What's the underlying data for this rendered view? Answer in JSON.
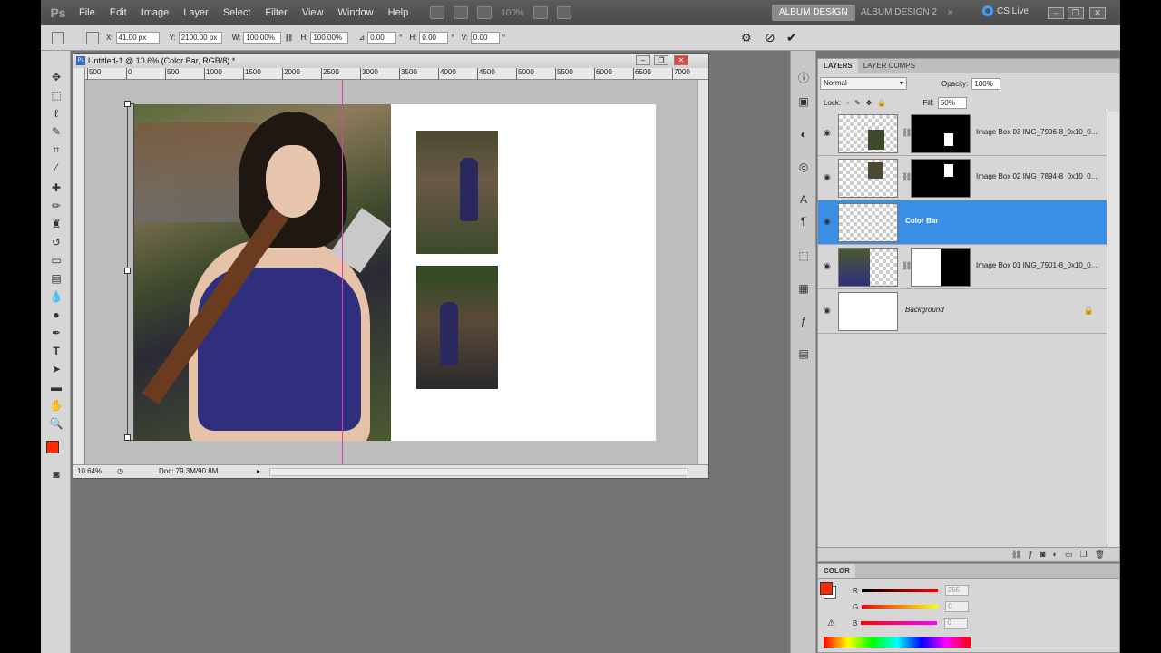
{
  "app": {
    "logo": "Ps"
  },
  "menu": [
    "File",
    "Edit",
    "Image",
    "Layer",
    "Select",
    "Filter",
    "View",
    "Window",
    "Help"
  ],
  "menubar": {
    "zoom": "100%",
    "workspaces": [
      "ALBUM DESIGN",
      "ALBUM DESIGN 2"
    ],
    "more": "»",
    "cs_live": "CS Live"
  },
  "options": {
    "x_label": "X:",
    "x_value": "41.00 px",
    "y_label": "Y:",
    "y_value": "2100.00 px",
    "w_label": "W:",
    "w_value": "100.00%",
    "h_label": "H:",
    "h_value": "100.00%",
    "angle_value": "0.00",
    "hskew_label": "H:",
    "hskew_value": "0.00",
    "vskew_label": "V:",
    "vskew_value": "0.00",
    "degree": "°"
  },
  "document": {
    "title": "Untitled-1 @ 10.6% (Color Bar, RGB/8) *",
    "ruler_marks": [
      "500",
      "0",
      "500",
      "1000",
      "1500",
      "2000",
      "2500",
      "3000",
      "3500",
      "4000",
      "4500",
      "5000",
      "5500",
      "6000",
      "6500",
      "7000"
    ],
    "zoom": "10.64%",
    "doc_info": "Doc: 79.3M/90.8M"
  },
  "layers_panel": {
    "tabs": [
      "LAYERS",
      "LAYER COMPS"
    ],
    "blend_mode": "Normal",
    "opacity_label": "Opacity:",
    "opacity": "100%",
    "lock_label": "Lock:",
    "fill_label": "Fill:",
    "fill": "50%",
    "layers": [
      {
        "name": "Image Box 03 IMG_7906-8_0x10_0...",
        "selected": false
      },
      {
        "name": "Image Box 02 IMG_7894-8_0x10_0...",
        "selected": false
      },
      {
        "name": "Color Bar",
        "selected": true
      },
      {
        "name": "Image Box 01 IMG_7901-8_0x10_0...",
        "selected": false
      },
      {
        "name": "Background",
        "selected": false
      }
    ]
  },
  "color_panel": {
    "tab": "COLOR",
    "r_label": "R",
    "r_value": "255",
    "g_label": "G",
    "g_value": "0",
    "b_label": "B",
    "b_value": "0",
    "foreground": "#ff2a00"
  }
}
